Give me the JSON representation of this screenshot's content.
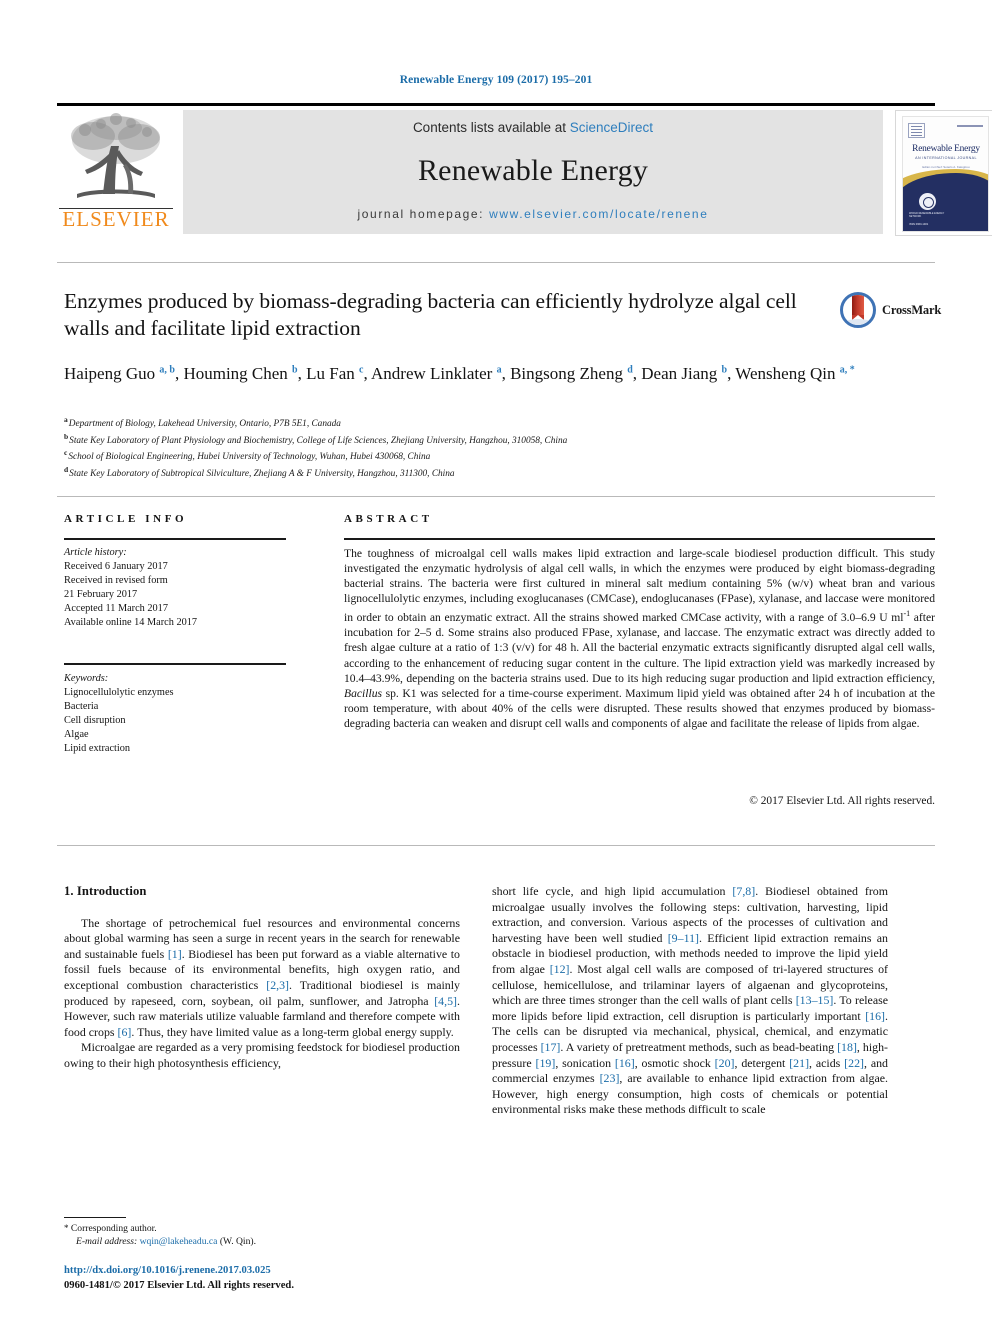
{
  "running_head": "Renewable Energy 109 (2017) 195–201",
  "masthead": {
    "publisher_name": "ELSEVIER",
    "contents_prefix": "Contents lists available at ",
    "contents_link": "ScienceDirect",
    "journal_title": "Renewable Energy",
    "homepage_prefix": "journal homepage: ",
    "homepage_url": "www.elsevier.com/locate/renene",
    "cover": {
      "title": "Renewable Energy",
      "subtitle": "AN INTERNATIONAL JOURNAL",
      "tagline": "Editor-in-Chief: Soteris A. Kalogirou",
      "seal_text": "WORLD RENEWABLE ENERGY NETWORK",
      "bottom_text": "ISSN 0960-1481"
    }
  },
  "crossmark": {
    "label": "CrossMark"
  },
  "article": {
    "title": "Enzymes produced by biomass-degrading bacteria can efficiently hydrolyze algal cell walls and facilitate lipid extraction",
    "authors": [
      {
        "name": "Haipeng Guo",
        "marks": "a, b",
        "sep": ", "
      },
      {
        "name": "Houming Chen",
        "marks": "b",
        "sep": ", "
      },
      {
        "name": "Lu Fan",
        "marks": "c",
        "sep": ", "
      },
      {
        "name": "Andrew Linklater",
        "marks": "a",
        "sep": ", "
      },
      {
        "name": "Bingsong Zheng",
        "marks": "d",
        "sep": ", "
      },
      {
        "name": "Dean Jiang",
        "marks": "b",
        "sep": ", "
      },
      {
        "name": "Wensheng Qin",
        "marks": "a, *",
        "sep": ""
      }
    ],
    "affiliations": [
      {
        "marker": "a",
        "text": "Department of Biology, Lakehead University, Ontario, P7B 5E1, Canada"
      },
      {
        "marker": "b",
        "text": "State Key Laboratory of Plant Physiology and Biochemistry, College of Life Sciences, Zhejiang University, Hangzhou, 310058, China"
      },
      {
        "marker": "c",
        "text": "School of Biological Engineering, Hubei University of Technology, Wuhan, Hubei 430068, China"
      },
      {
        "marker": "d",
        "text": "State Key Laboratory of Subtropical Silviculture, Zhejiang A & F University, Hangzhou, 311300, China"
      }
    ]
  },
  "article_info": {
    "heading": "ARTICLE INFO",
    "history_label": "Article history:",
    "history": [
      "Received 6 January 2017",
      "Received in revised form",
      "21 February 2017",
      "Accepted 11 March 2017",
      "Available online 14 March 2017"
    ],
    "keywords_label": "Keywords:",
    "keywords": [
      "Lignocellulolytic enzymes",
      "Bacteria",
      "Cell disruption",
      "Algae",
      "Lipid extraction"
    ]
  },
  "abstract": {
    "heading": "ABSTRACT",
    "part1": "The toughness of microalgal cell walls makes lipid extraction and large-scale biodiesel production difficult. This study investigated the enzymatic hydrolysis of algal cell walls, in which the enzymes were produced by eight biomass-degrading bacterial strains. The bacteria were first cultured in mineral salt medium containing 5% (w/v) wheat bran and various lignocellulolytic enzymes, including exoglucanases (CMCase), endoglucanases (FPase), xylanase, and laccase were monitored in order to obtain an enzymatic extract. All the strains showed marked CMCase activity, with a range of 3.0–6.9 U ml",
    "sup1": "-1",
    "part2": " after incubation for 2–5 d. Some strains also produced FPase, xylanase, and laccase. The enzymatic extract was directly added to fresh algae culture at a ratio of 1:3 (v/v) for 48 h. All the bacterial enzymatic extracts significantly disrupted algal cell walls, according to the enhancement of reducing sugar content in the culture. The lipid extraction yield was markedly increased by 10.4–43.9%, depending on the bacteria strains used. Due to its high reducing sugar production and lipid extraction efficiency, ",
    "italic1": "Bacillus",
    "part3": " sp. K1 was selected for a time-course experiment. Maximum lipid yield was obtained after 24 h of incubation at the room temperature, with about 40% of the cells were disrupted. These results showed that enzymes produced by biomass-degrading bacteria can weaken and disrupt cell walls and components of algae and facilitate the release of lipids from algae.",
    "copyright": "© 2017 Elsevier Ltd. All rights reserved."
  },
  "body": {
    "section_heading": "1. Introduction",
    "left_p1_a": "The shortage of petrochemical fuel resources and environmental concerns about global warming has seen a surge in recent years in the search for renewable and sustainable fuels ",
    "left_c1": "[1]",
    "left_p1_b": ". Biodiesel has been put forward as a viable alternative to fossil fuels because of its environmental benefits, high oxygen ratio, and exceptional combustion characteristics ",
    "left_c2": "[2,3]",
    "left_p1_c": ". Traditional biodiesel is mainly produced by rapeseed, corn, soybean, oil palm, sunflower, and Jatropha ",
    "left_c3": "[4,5]",
    "left_p1_d": ". However, such raw materials utilize valuable farmland and therefore compete with food crops ",
    "left_c4": "[6]",
    "left_p1_e": ". Thus, they have limited value as a long-term global energy supply.",
    "left_p2": "Microalgae are regarded as a very promising feedstock for biodiesel production owing to their high photosynthesis efficiency,",
    "right_a": "short life cycle, and high lipid accumulation ",
    "right_c1": "[7,8]",
    "right_b": ". Biodiesel obtained from microalgae usually involves the following steps: cultivation, harvesting, lipid extraction, and conversion. Various aspects of the processes of cultivation and harvesting have been well studied ",
    "right_c2": "[9–11]",
    "right_c": ". Efficient lipid extraction remains an obstacle in biodiesel production, with methods needed to improve the lipid yield from algae ",
    "right_c3": "[12]",
    "right_d": ". Most algal cell walls are composed of tri-layered structures of cellulose, hemicellulose, and trilaminar layers of algaenan and glycoproteins, which are three times stronger than the cell walls of plant cells ",
    "right_c4": "[13–15]",
    "right_e": ". To release more lipids before lipid extraction, cell disruption is particularly important ",
    "right_c5": "[16]",
    "right_f": ". The cells can be disrupted via mechanical, physical, chemical, and enzymatic processes ",
    "right_c6": "[17]",
    "right_g": ". A variety of pretreatment methods, such as bead-beating ",
    "right_c7": "[18]",
    "right_h": ", high-pressure ",
    "right_c8": "[19]",
    "right_i": ", sonication ",
    "right_c9": "[16]",
    "right_j": ", osmotic shock ",
    "right_c10": "[20]",
    "right_k": ", detergent ",
    "right_c11": "[21]",
    "right_l": ", acids ",
    "right_c12": "[22]",
    "right_m": ", and commercial enzymes ",
    "right_c13": "[23]",
    "right_n": ", are available to enhance lipid extraction from algae. However, high energy consumption, high costs of chemicals or potential environmental risks make these methods difficult to scale"
  },
  "footer": {
    "corresponding_star": "*",
    "corresponding_label": " Corresponding author.",
    "email_label": "E-mail address:",
    "email": "wqin@lakeheadu.ca",
    "email_suffix": " (W. Qin).",
    "doi": "http://dx.doi.org/10.1016/j.renene.2017.03.025",
    "issn_line": "0960-1481/© 2017 Elsevier Ltd. All rights reserved."
  },
  "colors": {
    "link_blue": "#1b6ca8",
    "sd_blue": "#2e7ebd",
    "elsevier_orange": "#f08a1c",
    "cover_navy": "#232f62",
    "cover_gold": "#d8b64a"
  }
}
